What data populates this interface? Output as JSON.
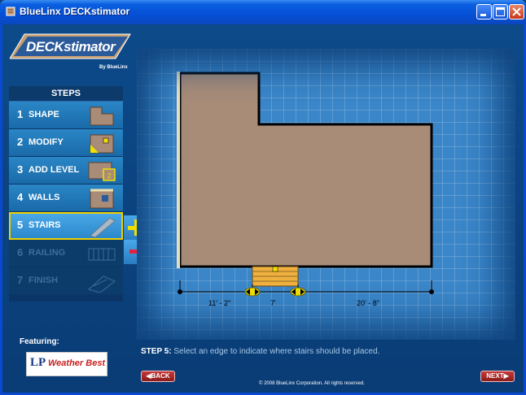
{
  "window": {
    "title": "BlueLinx DECKstimator"
  },
  "logo": {
    "text": "DECKstimator",
    "tagline": "By BlueLinx"
  },
  "steps": {
    "header": "STEPS",
    "items": [
      {
        "num": "1",
        "label": "SHAPE",
        "state": "normal"
      },
      {
        "num": "2",
        "label": "MODIFY",
        "state": "normal"
      },
      {
        "num": "3",
        "label": "ADD LEVEL",
        "state": "normal"
      },
      {
        "num": "4",
        "label": "WALLS",
        "state": "normal"
      },
      {
        "num": "5",
        "label": "STAIRS",
        "state": "active"
      },
      {
        "num": "6",
        "label": "RAILING",
        "state": "disabled"
      },
      {
        "num": "7",
        "label": "FINISH",
        "state": "disabled"
      }
    ],
    "add_symbol": "+",
    "remove_symbol": "−"
  },
  "deck": {
    "dimensions": [
      "11' - 2\"",
      "7'",
      "20' - 8\""
    ],
    "colors": {
      "deck": "#a88c78",
      "stairs": "#f0b040",
      "accent": "#f0d000"
    }
  },
  "featuring": {
    "label": "Featuring:",
    "brand_lp": "LP",
    "brand_name": "Weather Best"
  },
  "instruction": {
    "step": "STEP 5:",
    "text": "Select an edge to indicate where stairs should be placed."
  },
  "nav": {
    "back": "BACK",
    "next": "NEXT"
  },
  "footer": {
    "copyright": "© 2008 BlueLinx Corporation.  All rights reserved."
  }
}
